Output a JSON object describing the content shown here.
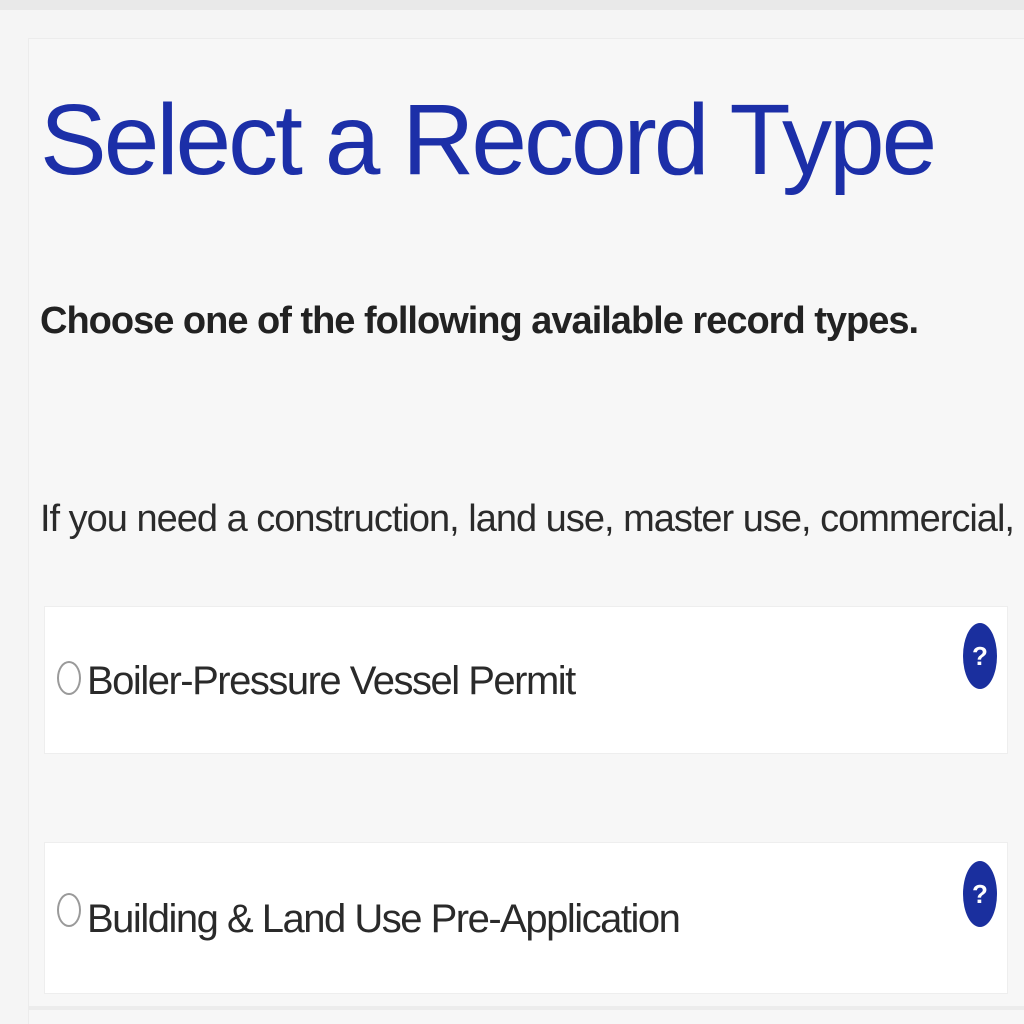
{
  "page": {
    "title": "Select a Record Type",
    "subtitle": "Choose one of the following available record types.",
    "info_text": "If you need a construction, land use, master use, commercial, or mechanical perm"
  },
  "records": [
    {
      "label": "Boiler-Pressure Vessel Permit",
      "selected": false,
      "help_icon": "?"
    },
    {
      "label": "Building & Land Use Pre-Application",
      "selected": false,
      "help_icon": "?"
    }
  ],
  "colors": {
    "title": "#1c2fa8",
    "help_icon": "#1a2f9e",
    "text": "#222222",
    "background": "#f5f5f5",
    "card": "#ffffff"
  },
  "icons": {
    "help": "question-circle-icon",
    "radio": "radio-unchecked-icon"
  }
}
